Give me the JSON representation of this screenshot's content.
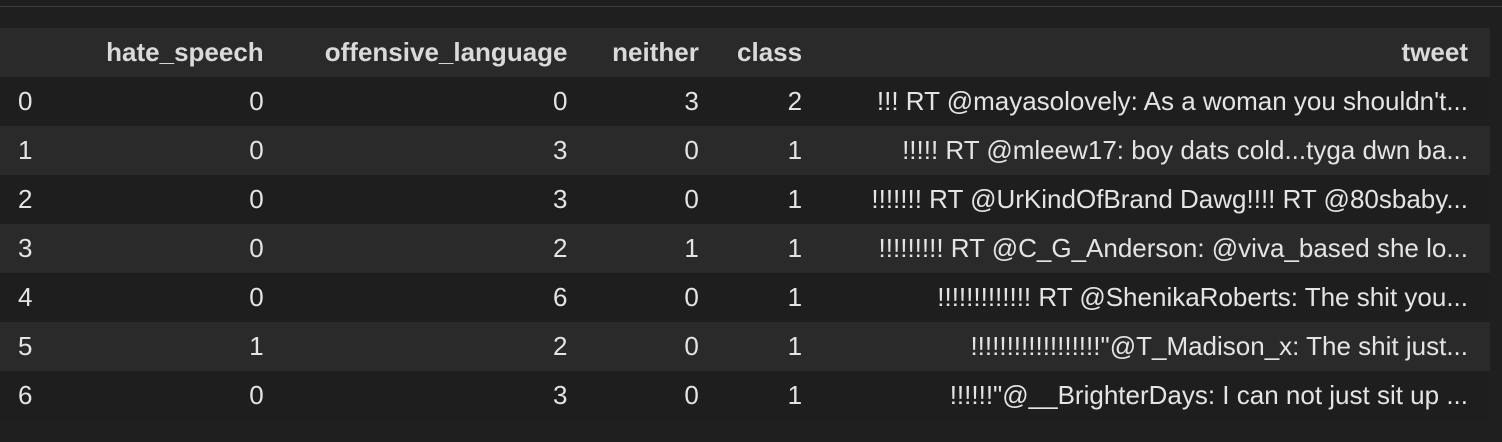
{
  "table": {
    "index_header": "",
    "columns": [
      "hate_speech",
      "offensive_language",
      "neither",
      "class",
      "tweet"
    ],
    "rows": [
      {
        "index": "0",
        "hate_speech": "0",
        "offensive_language": "0",
        "neither": "3",
        "class": "2",
        "tweet": "!!! RT @mayasolovely: As a woman you shouldn't..."
      },
      {
        "index": "1",
        "hate_speech": "0",
        "offensive_language": "3",
        "neither": "0",
        "class": "1",
        "tweet": "!!!!! RT @mleew17: boy dats cold...tyga dwn ba..."
      },
      {
        "index": "2",
        "hate_speech": "0",
        "offensive_language": "3",
        "neither": "0",
        "class": "1",
        "tweet": "!!!!!!! RT @UrKindOfBrand Dawg!!!! RT @80sbaby..."
      },
      {
        "index": "3",
        "hate_speech": "0",
        "offensive_language": "2",
        "neither": "1",
        "class": "1",
        "tweet": "!!!!!!!!! RT @C_G_Anderson: @viva_based she lo..."
      },
      {
        "index": "4",
        "hate_speech": "0",
        "offensive_language": "6",
        "neither": "0",
        "class": "1",
        "tweet": "!!!!!!!!!!!!! RT @ShenikaRoberts: The shit you..."
      },
      {
        "index": "5",
        "hate_speech": "1",
        "offensive_language": "2",
        "neither": "0",
        "class": "1",
        "tweet": "!!!!!!!!!!!!!!!!!!\"@T_Madison_x: The shit just..."
      },
      {
        "index": "6",
        "hate_speech": "0",
        "offensive_language": "3",
        "neither": "0",
        "class": "1",
        "tweet": "!!!!!!\"@__BrighterDays: I can not just sit up ..."
      }
    ]
  }
}
